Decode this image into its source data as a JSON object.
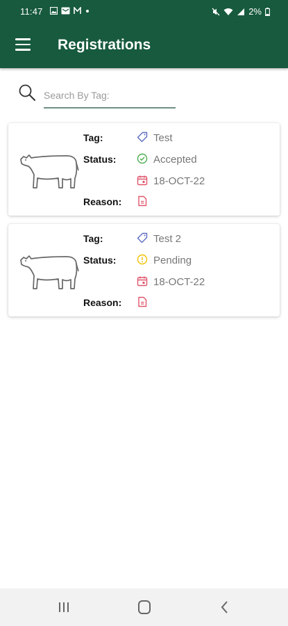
{
  "status_bar": {
    "time": "11:47",
    "battery": "2%"
  },
  "app_bar": {
    "title": "Registrations"
  },
  "search": {
    "placeholder": "Search By Tag:"
  },
  "labels": {
    "tag": "Tag:",
    "status": "Status:",
    "reason": "Reason:"
  },
  "registrations": [
    {
      "tag": "Test",
      "status": "Accepted",
      "date": "18-OCT-22"
    },
    {
      "tag": "Test 2",
      "status": "Pending",
      "date": "18-OCT-22"
    }
  ],
  "colors": {
    "brand": "#175a3e",
    "accepted": "#4caf50",
    "pending": "#f2c200",
    "tag_icon": "#5c6bc0",
    "date_icon": "#e0566b",
    "reason_icon": "#e0566b"
  }
}
